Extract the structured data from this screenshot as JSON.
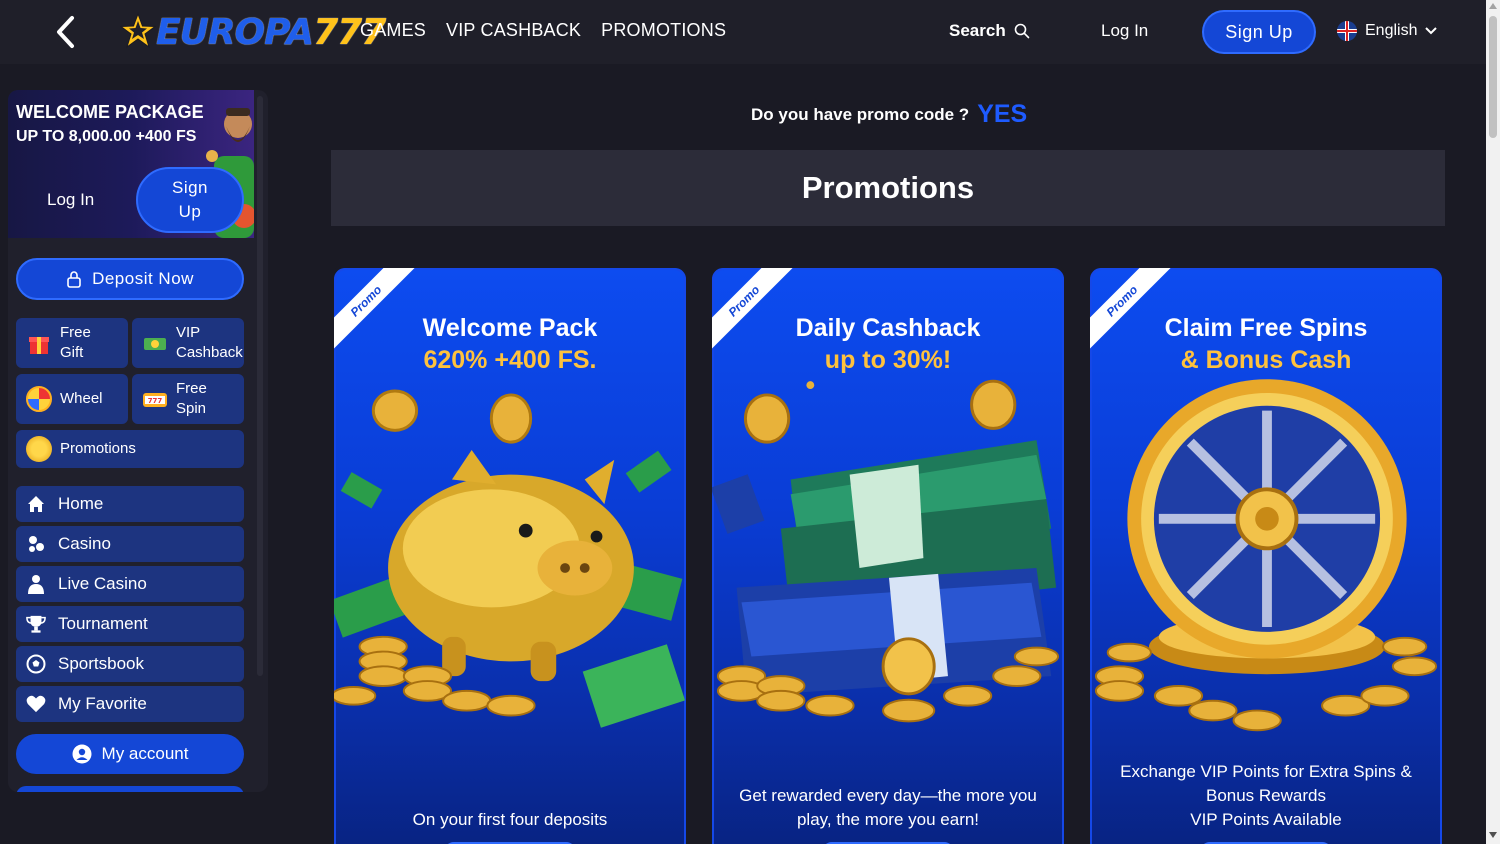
{
  "header": {
    "logo_main": "EUROPA",
    "logo_num": "777",
    "nav": [
      "GAMES",
      "VIP CASHBACK",
      "PROMOTIONS"
    ],
    "search_label": "Search",
    "login_label": "Log In",
    "signup_label": "Sign Up",
    "language": "English"
  },
  "sidebar": {
    "welcome_title": "WELCOME PACKAGE",
    "welcome_sub": "UP TO 8,000.00 +400 FS",
    "login_label": "Log In",
    "signup_line1": "Sign",
    "signup_line2": "Up",
    "deposit_label": "Deposit Now",
    "tiles": [
      {
        "line1": "Free",
        "line2": "Gift",
        "icon": "gift-icon"
      },
      {
        "line1": "VIP",
        "line2": "Cashback",
        "icon": "cash-icon"
      },
      {
        "line1": "Wheel",
        "line2": "",
        "icon": "wheel-icon"
      },
      {
        "line1": "Free",
        "line2": "Spin",
        "icon": "slot-icon"
      }
    ],
    "promotions_label": "Promotions",
    "menu": [
      {
        "label": "Home",
        "icon": "home-icon"
      },
      {
        "label": "Casino",
        "icon": "casino-icon"
      },
      {
        "label": "Live Casino",
        "icon": "dealer-icon"
      },
      {
        "label": "Tournament",
        "icon": "trophy-icon"
      },
      {
        "label": "Sportsbook",
        "icon": "soccer-ball-icon"
      },
      {
        "label": "My Favorite",
        "icon": "heart-icon"
      }
    ],
    "my_account_label": "My account"
  },
  "main": {
    "promo_question": "Do you have promo code ?",
    "promo_yes": "YES",
    "page_title": "Promotions",
    "cards": [
      {
        "ribbon": "Promo",
        "title": "Welcome Pack",
        "subtitle": "620% +400 FS.",
        "desc_lines": [
          "On your first four deposits"
        ],
        "art": "piggy-bank"
      },
      {
        "ribbon": "Promo",
        "title": "Daily Cashback",
        "subtitle": "up to 30%!",
        "desc_lines": [
          "Get rewarded every day—the more you",
          "play, the more you earn!"
        ],
        "art": "money-stack"
      },
      {
        "ribbon": "Promo",
        "title": "Claim Free Spins",
        "subtitle": "& Bonus Cash",
        "desc_lines": [
          "Exchange VIP Points for Extra Spins &",
          "Bonus Rewards",
          "VIP Points Available"
        ],
        "art": "golden-wheel"
      }
    ]
  },
  "colors": {
    "accent_blue": "#1447d6",
    "gold": "#ffc23d",
    "bg": "#1a1a24"
  }
}
